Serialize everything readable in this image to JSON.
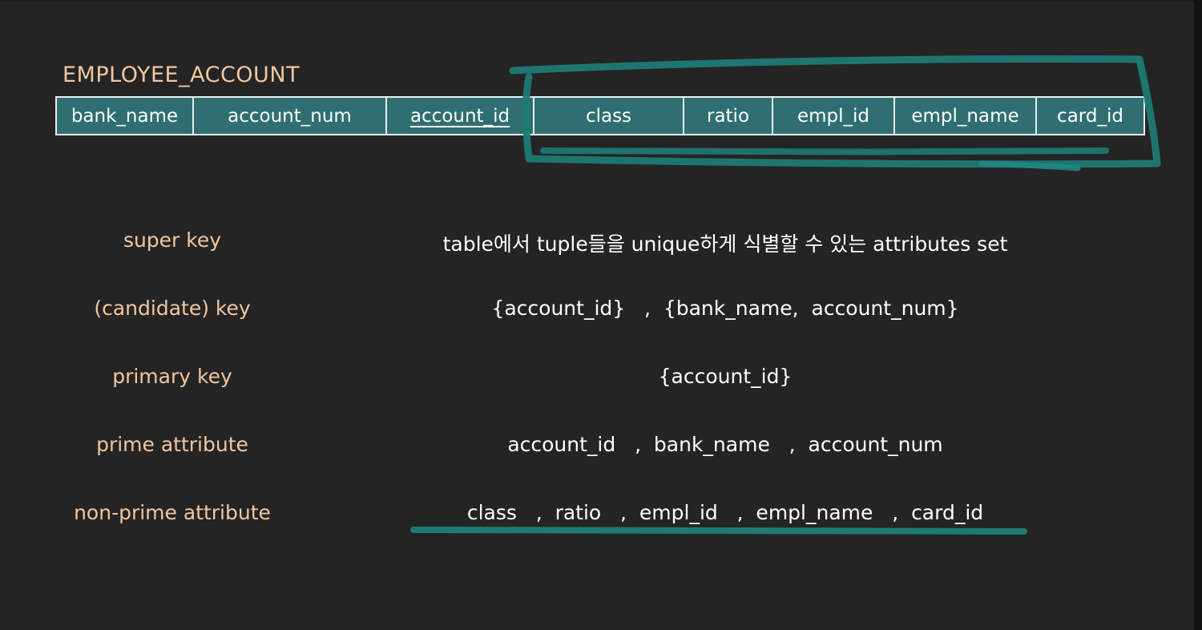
{
  "table": {
    "title": "EMPLOYEE_ACCOUNT",
    "columns": [
      {
        "label": "bank_name",
        "primary_key": false
      },
      {
        "label": "account_num",
        "primary_key": false
      },
      {
        "label": "account_id",
        "primary_key": true
      },
      {
        "label": "class",
        "primary_key": false
      },
      {
        "label": "ratio",
        "primary_key": false
      },
      {
        "label": "empl_id",
        "primary_key": false
      },
      {
        "label": "empl_name",
        "primary_key": false
      },
      {
        "label": "card_id",
        "primary_key": false
      }
    ]
  },
  "definitions": [
    {
      "term": "super key",
      "value": "table에서 tuple들을 unique하게 식별할 수 있는 attributes set"
    },
    {
      "term": "(candidate) key",
      "value": "{account_id}   ,  {bank_name,  account_num}"
    },
    {
      "term": "primary key",
      "value": "{account_id}"
    },
    {
      "term": "prime attribute",
      "value": "account_id   ,  bank_name   ,  account_num"
    },
    {
      "term": "non-prime attribute",
      "value": "class   ,  ratio   ,  empl_id   ,  empl_name   ,  card_id"
    }
  ],
  "colors": {
    "background": "#242424",
    "label": "#f2c6a0",
    "text": "#ffffff",
    "table_fill": "#2f6f72",
    "annotation": "#1f7a74"
  }
}
